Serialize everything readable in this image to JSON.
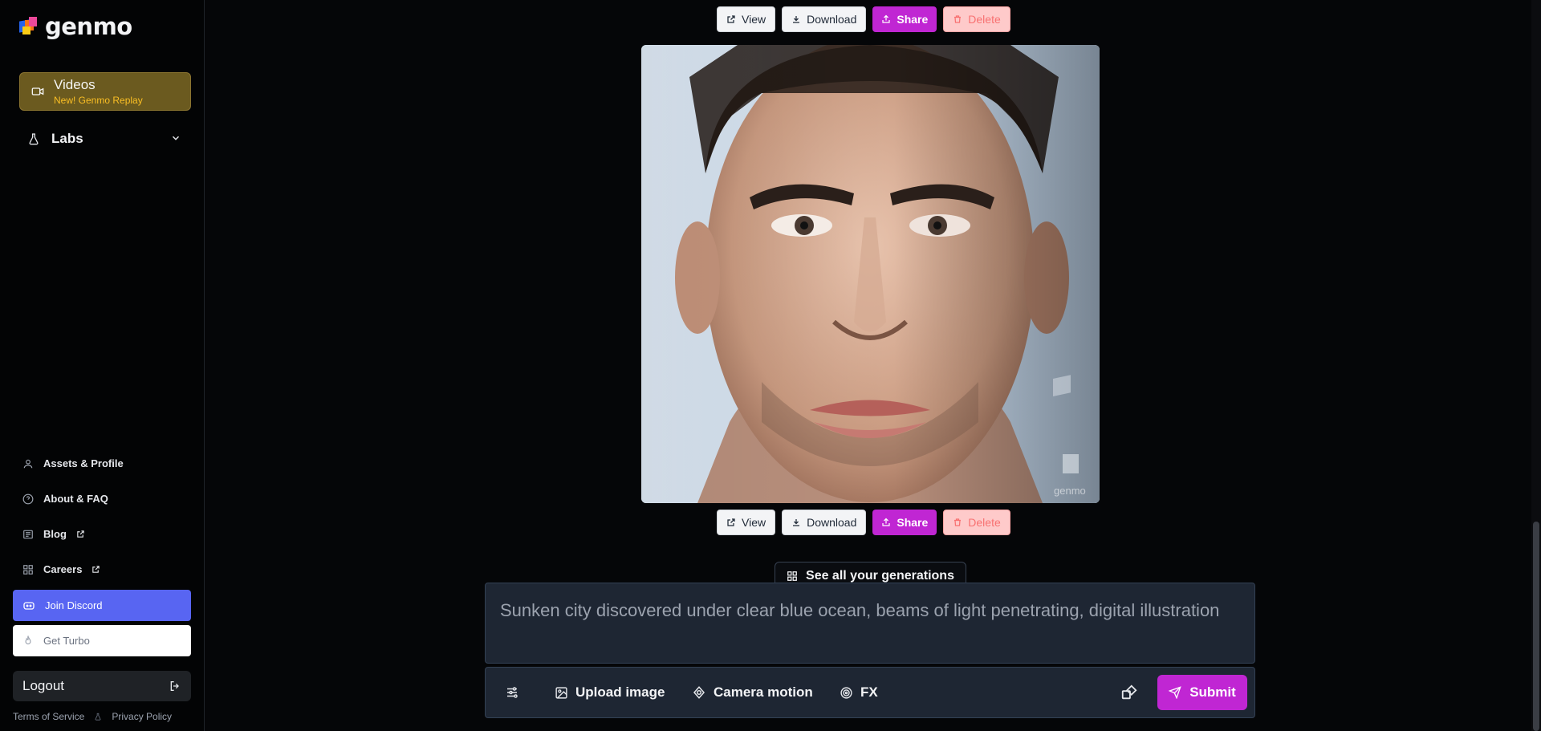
{
  "app": {
    "logo_text": "genmo"
  },
  "sidebar": {
    "videos": {
      "label": "Videos",
      "sublabel": "New! Genmo Replay"
    },
    "labs": {
      "label": "Labs"
    },
    "links": [
      {
        "label": "Assets & Profile",
        "icon": "user-icon"
      },
      {
        "label": "About & FAQ",
        "icon": "help-circle-icon"
      },
      {
        "label": "Blog",
        "icon": "newspaper-icon",
        "external": true
      },
      {
        "label": "Careers",
        "icon": "grid-icon",
        "external": true
      }
    ],
    "discord_label": "Join Discord",
    "turbo_label": "Get Turbo",
    "logout_label": "Logout",
    "footer": {
      "terms": "Terms of Service",
      "privacy": "Privacy Policy"
    }
  },
  "actions": {
    "view": "View",
    "download": "Download",
    "share": "Share",
    "delete": "Delete"
  },
  "image": {
    "watermark": "genmo"
  },
  "see_all_label": "See all your generations",
  "prompt": {
    "placeholder": "Sunken city discovered under clear blue ocean, beams of light penetrating, digital illustration"
  },
  "toolbar": {
    "upload_label": "Upload image",
    "camera_label": "Camera motion",
    "fx_label": "FX",
    "submit_label": "Submit"
  },
  "colors": {
    "accent": "#c026d3",
    "discord": "#5865f2",
    "videos_bg": "#6b5a1f"
  }
}
